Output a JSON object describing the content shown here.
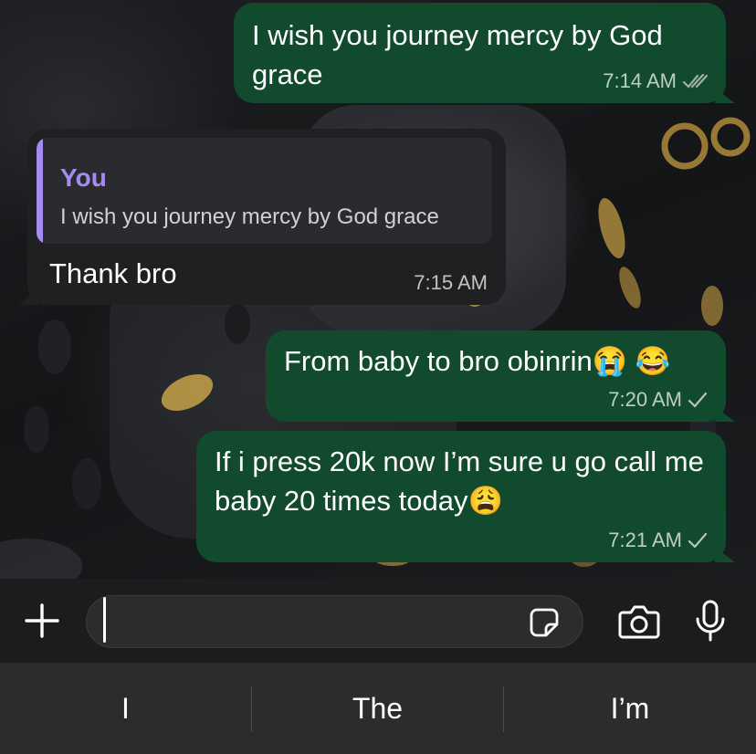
{
  "messages": [
    {
      "id": "m1",
      "direction": "outgoing",
      "text": "I wish you journey mercy by God grace",
      "time": "7:14 AM",
      "status": "read",
      "check_icon": "double-check-icon"
    },
    {
      "id": "m2",
      "direction": "incoming",
      "reply_to": {
        "author": "You",
        "text": "I wish you journey mercy by God grace"
      },
      "text": "Thank bro",
      "time": "7:15 AM"
    },
    {
      "id": "m3",
      "direction": "outgoing",
      "text": "From baby to bro obinrin😭 😂",
      "time": "7:20 AM",
      "status": "sent",
      "check_icon": "single-check-icon"
    },
    {
      "id": "m4",
      "direction": "outgoing",
      "text": "If i press 20k now I’m sure u go call me baby 20 times today😩",
      "time": "7:21 AM",
      "status": "sent",
      "check_icon": "single-check-icon"
    }
  ],
  "composer": {
    "attach_icon": "plus-icon",
    "text_value": "",
    "sticker_icon": "sticker-icon",
    "camera_icon": "camera-icon",
    "mic_icon": "microphone-icon"
  },
  "suggestions": [
    "I",
    "The",
    "I’m"
  ],
  "colors": {
    "outgoing_bubble": "#124a2e",
    "incoming_bubble": "#1f2022",
    "quote_accent": "#a68af3",
    "read_tick": "#9fb0a6"
  }
}
